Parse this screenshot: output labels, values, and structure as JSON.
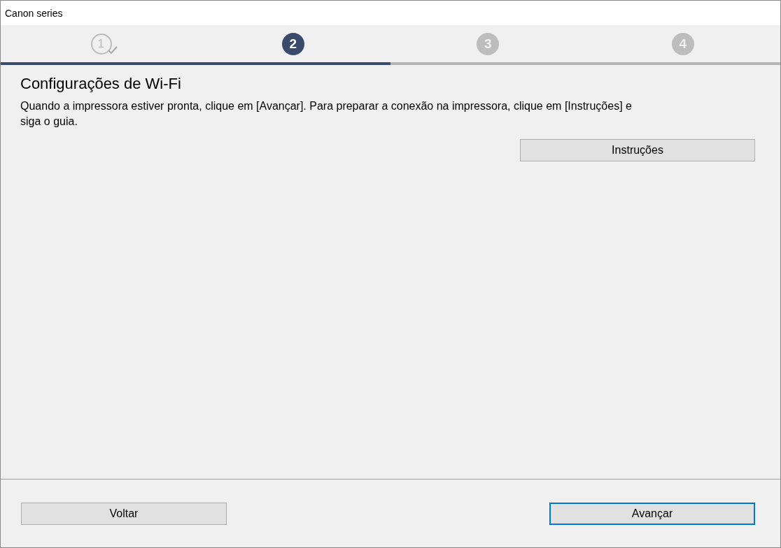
{
  "window": {
    "title": "Canon series"
  },
  "steps": [
    {
      "label": "1",
      "completed": true,
      "selected": false
    },
    {
      "label": "2",
      "completed": false,
      "selected": true
    },
    {
      "label": "3",
      "completed": false,
      "selected": false
    },
    {
      "label": "4",
      "completed": false,
      "selected": false
    }
  ],
  "progress": {
    "level": 0.5
  },
  "heading": "Configurações de Wi-Fi",
  "description": "Quando a impressora estiver pronta, clique em [Avançar]. Para preparar a conexão na impressora, clique em [Instruções] e siga o guia.",
  "instructions_button": {
    "label": "Instruções",
    "focused": false
  },
  "footer_buttons": [
    {
      "label": "Voltar",
      "focused": false
    },
    {
      "label": "Avançar",
      "focused": true
    }
  ]
}
